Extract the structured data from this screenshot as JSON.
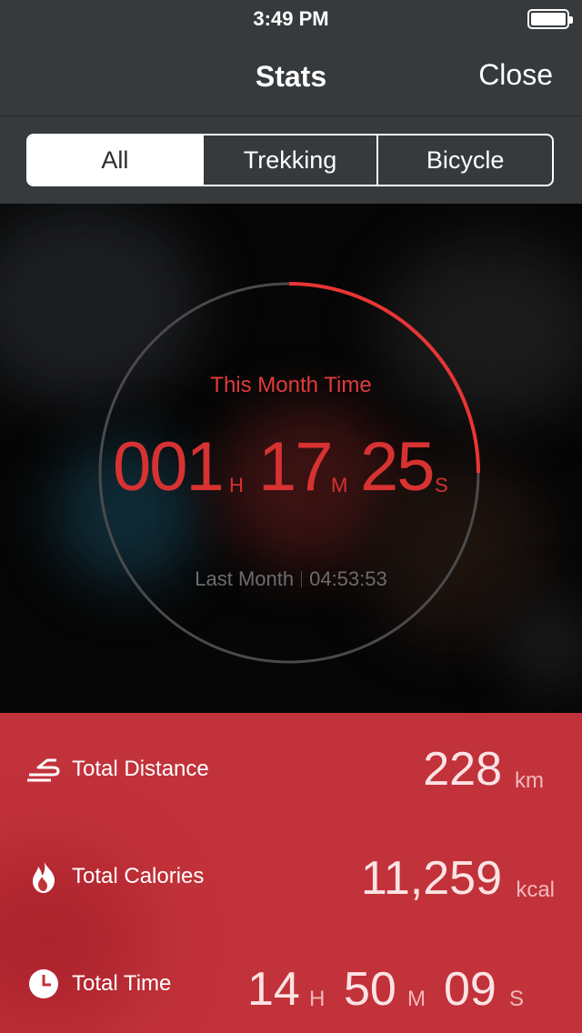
{
  "status_bar": {
    "time": "3:49 PM"
  },
  "nav": {
    "title": "Stats",
    "close_label": "Close"
  },
  "segments": [
    {
      "label": "All",
      "active": true
    },
    {
      "label": "Trekking",
      "active": false
    },
    {
      "label": "Bicycle",
      "active": false
    }
  ],
  "this_month": {
    "label": "This Month Time",
    "hours": "001",
    "hours_unit": "H",
    "minutes": "17",
    "minutes_unit": "M",
    "seconds": "25",
    "seconds_unit": "S",
    "ring_progress": 0.25
  },
  "last_month": {
    "label": "Last Month",
    "value": "04:53:53"
  },
  "stats": {
    "distance": {
      "label": "Total Distance",
      "value": "228",
      "unit": "km",
      "icon": "road-icon"
    },
    "calories": {
      "label": "Total Calories",
      "value": "11,259",
      "unit": "kcal",
      "icon": "flame-icon"
    },
    "time": {
      "label": "Total Time",
      "hours": "14",
      "hours_unit": "H",
      "minutes": "50",
      "minutes_unit": "M",
      "seconds": "09",
      "seconds_unit": "S",
      "icon": "clock-icon"
    }
  },
  "colors": {
    "accent": "#e23b3b",
    "stats_bg": "#c2323a",
    "nav_bg": "#373a3d"
  }
}
